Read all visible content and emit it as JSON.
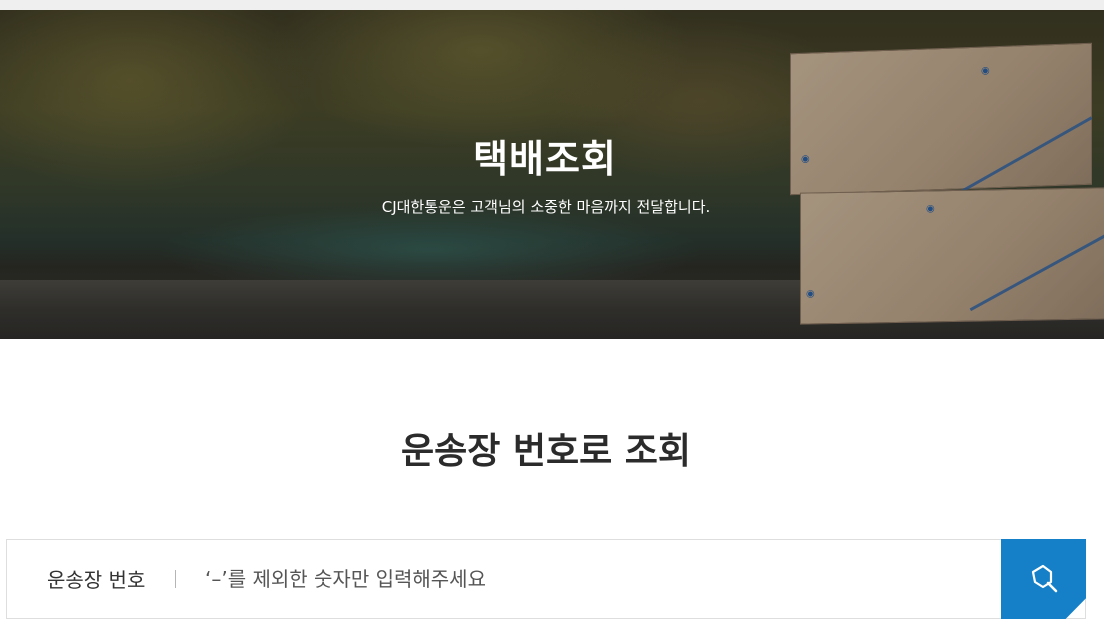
{
  "hero": {
    "title": "택배조회",
    "subtitle": "CJ대한통운은 고객님의 소중한 마음까지 전달합니다."
  },
  "section": {
    "title": "운송장 번호로 조회"
  },
  "search": {
    "label": "운송장 번호",
    "placeholder": "‘–’를 제외한 숫자만 입력해주세요",
    "value": "",
    "button_icon": "search-icon",
    "button_color": "#1580c8"
  },
  "colors": {
    "accent": "#1580c8",
    "title_text": "#2b2b2b"
  }
}
